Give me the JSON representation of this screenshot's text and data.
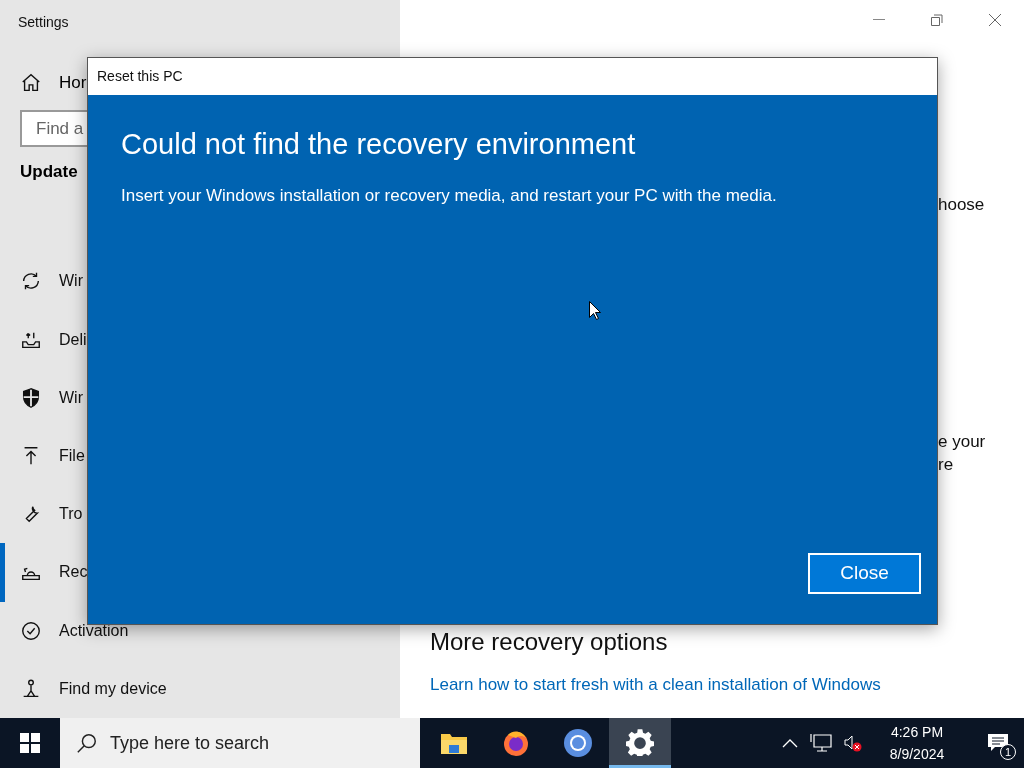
{
  "settings_window": {
    "title": "Settings",
    "sidebar": {
      "home": "Hor",
      "search_placeholder": "Find a",
      "section": "Update",
      "items": [
        {
          "label": "Wir",
          "kind": "sync",
          "selected": false
        },
        {
          "label": "Deli",
          "kind": "delivery",
          "selected": false
        },
        {
          "label": "Wir",
          "kind": "shield",
          "selected": false
        },
        {
          "label": "File",
          "kind": "upload",
          "selected": false
        },
        {
          "label": "Tro",
          "kind": "wrench",
          "selected": false
        },
        {
          "label": "Rec",
          "kind": "recovery",
          "selected": true
        },
        {
          "label": "Activation",
          "kind": "check",
          "selected": false
        },
        {
          "label": "Find my device",
          "kind": "person",
          "selected": false
        }
      ]
    },
    "content": {
      "fragment_1": "hoose",
      "fragment_2": [
        "e your",
        "re"
      ],
      "heading": "More recovery options",
      "link": "Learn how to start fresh with a clean installation of Windows"
    }
  },
  "dialog": {
    "title": "Reset this PC",
    "heading": "Could not find the recovery environment",
    "message": "Insert your Windows installation or recovery media, and restart your PC with the media.",
    "button": "Close"
  },
  "taskbar": {
    "search_placeholder": "Type here to search",
    "apps": [
      {
        "kind": "folder",
        "selected": false
      },
      {
        "kind": "firefox",
        "selected": false
      },
      {
        "kind": "chrome",
        "selected": false
      },
      {
        "kind": "gear",
        "selected": true
      }
    ],
    "time": "4:26 PM",
    "date": "8/9/2024",
    "notification_count": "1"
  }
}
